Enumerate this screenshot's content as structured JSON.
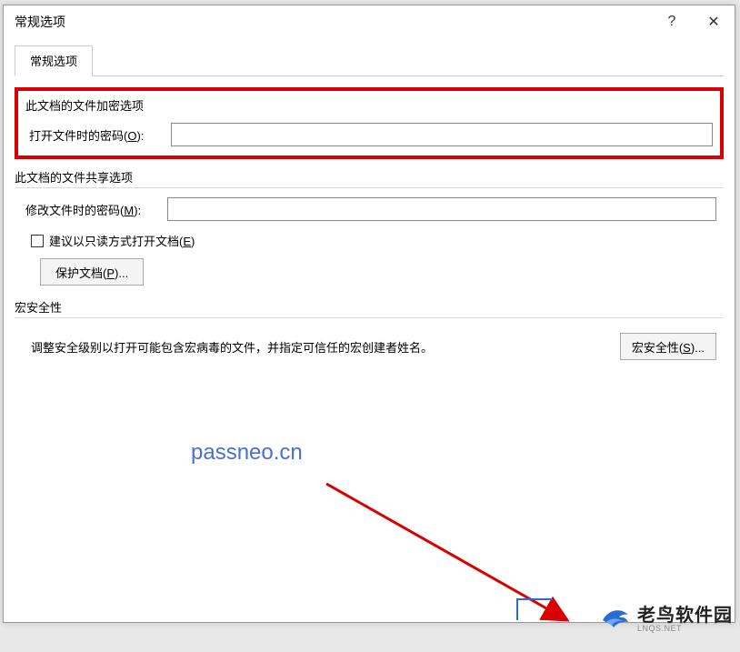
{
  "dialog": {
    "title": "常规选项",
    "help_icon": "?",
    "close_icon": "✕"
  },
  "tab": {
    "label": "常规选项"
  },
  "encrypt_section": {
    "title": "此文档的文件加密选项",
    "field_label_pre": "打开文件时的密码(",
    "field_key": "O",
    "field_label_post": "):",
    "value": ""
  },
  "share_section": {
    "title": "此文档的文件共享选项",
    "field_label_pre": "修改文件时的密码(",
    "field_key": "M",
    "field_label_post": "):",
    "value": "",
    "checkbox_pre": "建议以只读方式打开文档(",
    "checkbox_key": "E",
    "checkbox_post": ")",
    "protect_btn_pre": "保护文档(",
    "protect_btn_key": "P",
    "protect_btn_post": ")..."
  },
  "macro_section": {
    "title": "宏安全性",
    "desc": "调整安全级别以打开可能包含宏病毒的文件，并指定可信任的宏创建者姓名。",
    "btn_pre": "宏安全性(",
    "btn_key": "S",
    "btn_post": ")..."
  },
  "watermark": "passneo.cn",
  "logo": {
    "cn": "老鸟软件园",
    "en": "LNQS.NET"
  }
}
